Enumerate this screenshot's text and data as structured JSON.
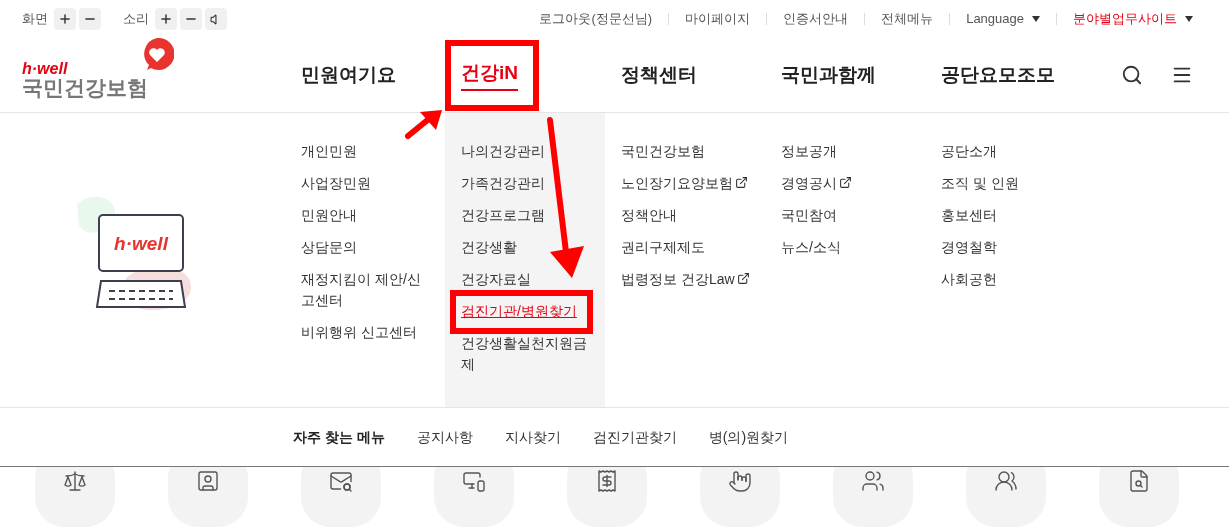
{
  "top_bar": {
    "screen_label": "화면",
    "sound_label": "소리",
    "links": [
      {
        "label": "로그아웃(정문선님)",
        "has_menu": false,
        "highlighted": false
      },
      {
        "label": "마이페이지",
        "has_menu": false,
        "highlighted": false
      },
      {
        "label": "인증서안내",
        "has_menu": false,
        "highlighted": false
      },
      {
        "label": "전체메뉴",
        "has_menu": false,
        "highlighted": false
      },
      {
        "label": "Language",
        "has_menu": true,
        "highlighted": false
      },
      {
        "label": "분야별업무사이트",
        "has_menu": true,
        "highlighted": true
      }
    ]
  },
  "logo": {
    "tagline": "h·well",
    "name": "국민건강보험"
  },
  "nav": [
    {
      "label": "민원여기요",
      "selected": false
    },
    {
      "label": "건강iN",
      "selected": true
    },
    {
      "label": "정책센터",
      "selected": false
    },
    {
      "label": "국민과함께",
      "selected": false
    },
    {
      "label": "공단요모조모",
      "selected": false
    }
  ],
  "illustration": {
    "screen_text": "h·well"
  },
  "dropdown": [
    {
      "items": [
        {
          "label": "개인민원",
          "external": false,
          "selected": false
        },
        {
          "label": "사업장민원",
          "external": false,
          "selected": false
        },
        {
          "label": "민원안내",
          "external": false,
          "selected": false
        },
        {
          "label": "상담문의",
          "external": false,
          "selected": false
        },
        {
          "label": "재정지킴이 제안/신고센터",
          "external": false,
          "selected": false
        },
        {
          "label": "비위행위 신고센터",
          "external": false,
          "selected": false
        }
      ]
    },
    {
      "items": [
        {
          "label": "나의건강관리",
          "external": false,
          "selected": false
        },
        {
          "label": "가족건강관리",
          "external": false,
          "selected": false
        },
        {
          "label": "건강프로그램",
          "external": false,
          "selected": false
        },
        {
          "label": "건강생활",
          "external": false,
          "selected": false
        },
        {
          "label": "건강자료실",
          "external": false,
          "selected": false
        },
        {
          "label": "검진기관/병원찾기",
          "external": false,
          "selected": true
        },
        {
          "label": "건강생활실천지원금제",
          "external": false,
          "selected": false
        }
      ]
    },
    {
      "items": [
        {
          "label": "국민건강보험",
          "external": false,
          "selected": false
        },
        {
          "label": "노인장기요양보험",
          "external": true,
          "selected": false
        },
        {
          "label": "정책안내",
          "external": false,
          "selected": false
        },
        {
          "label": "권리구제제도",
          "external": false,
          "selected": false
        },
        {
          "label": "법령정보 건강Law",
          "external": true,
          "selected": false
        }
      ]
    },
    {
      "items": [
        {
          "label": "정보공개",
          "external": false,
          "selected": false
        },
        {
          "label": "경영공시",
          "external": true,
          "selected": false
        },
        {
          "label": "국민참여",
          "external": false,
          "selected": false
        },
        {
          "label": "뉴스/소식",
          "external": false,
          "selected": false
        }
      ]
    },
    {
      "items": [
        {
          "label": "공단소개",
          "external": false,
          "selected": false
        },
        {
          "label": "조직 및 인원",
          "external": false,
          "selected": false
        },
        {
          "label": "홍보센터",
          "external": false,
          "selected": false
        },
        {
          "label": "경영철학",
          "external": false,
          "selected": false
        },
        {
          "label": "사회공헌",
          "external": false,
          "selected": false
        }
      ]
    }
  ],
  "quick_menu": {
    "title": "자주 찾는 메뉴",
    "links": [
      "공지사항",
      "지사찾기",
      "검진기관찾기",
      "병(의)원찾기"
    ]
  }
}
